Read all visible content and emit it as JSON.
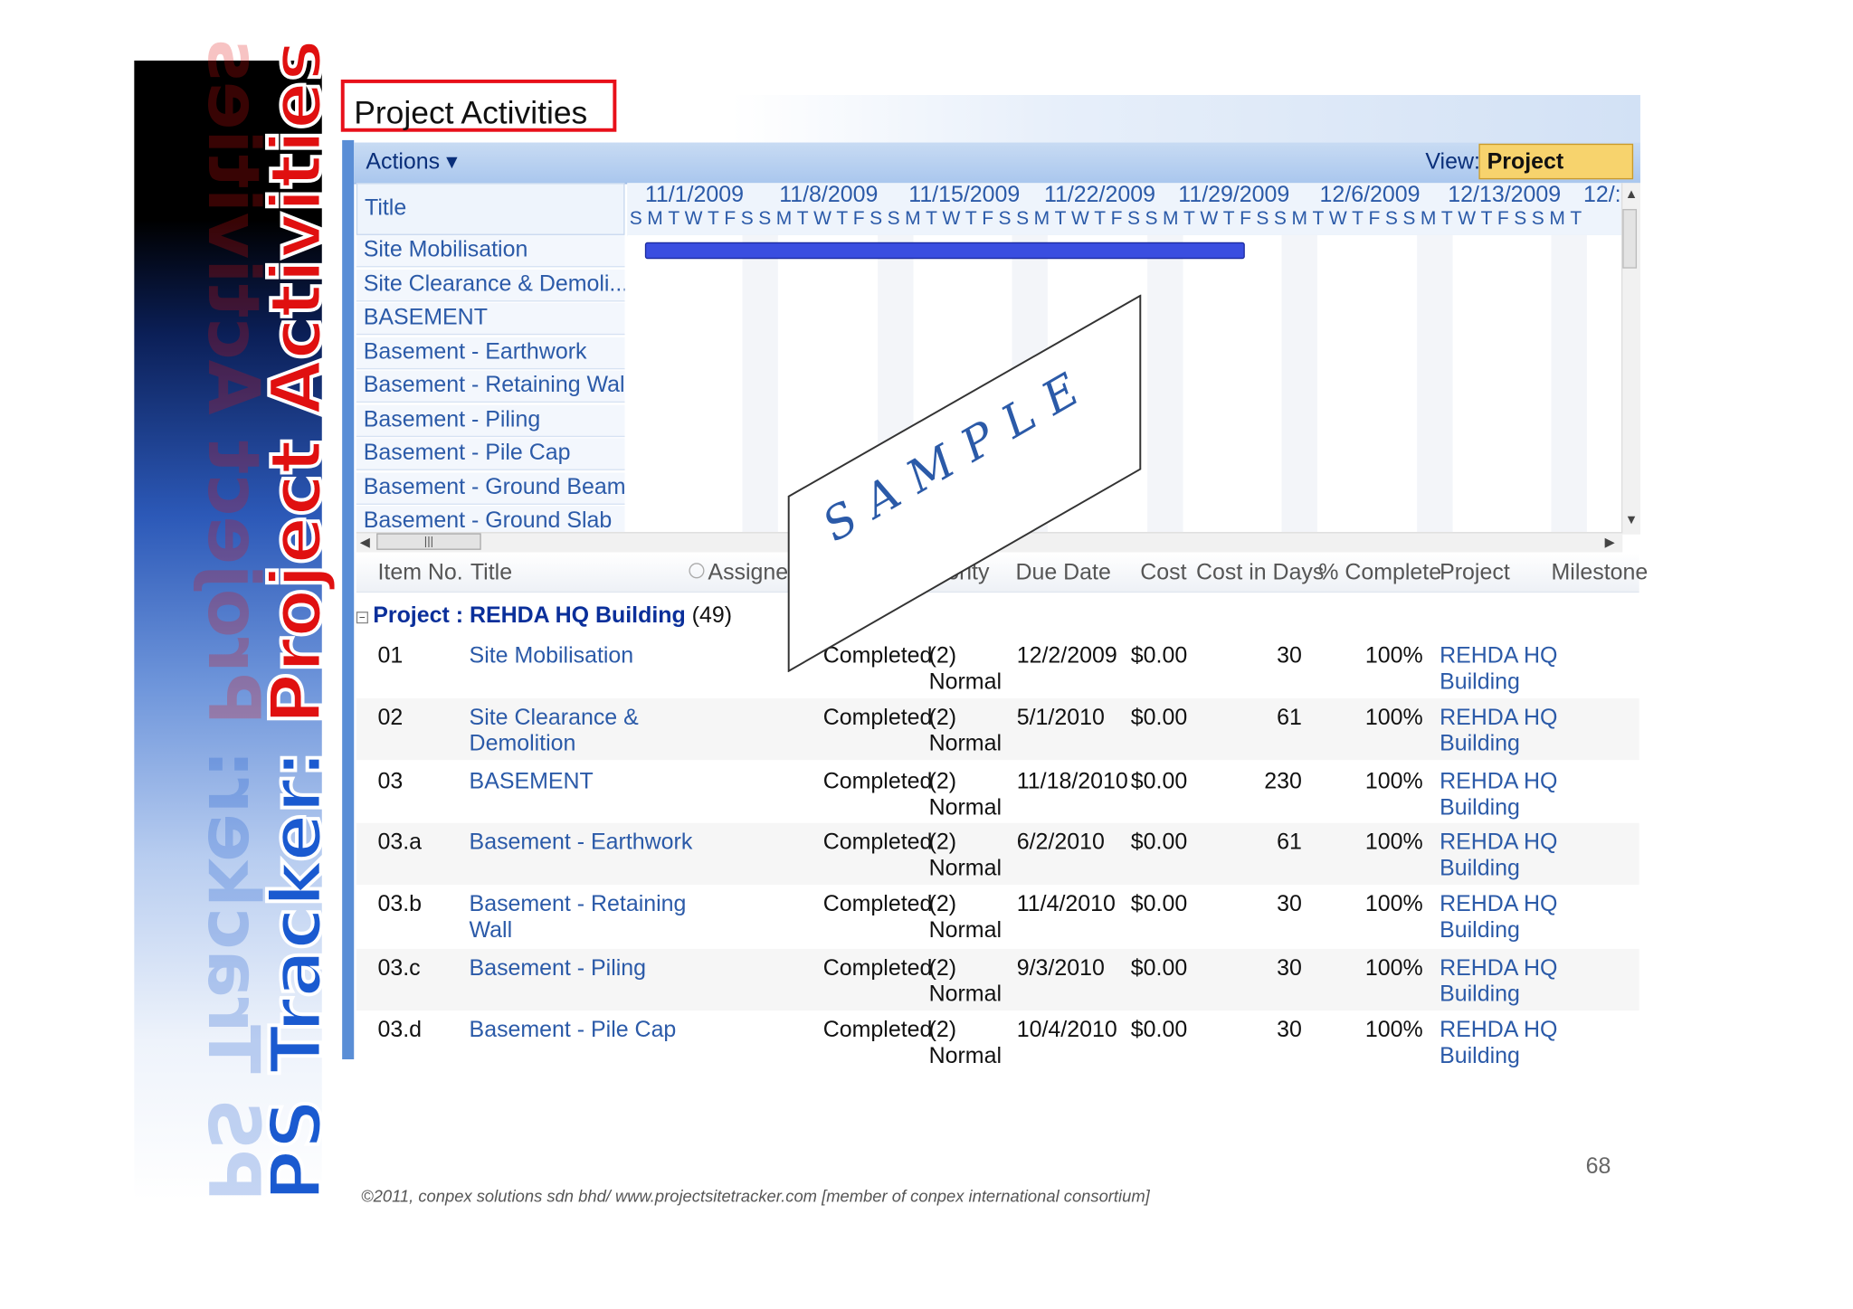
{
  "sidebar": {
    "prefix": "PS Tracker: ",
    "highlight": "Project Activities"
  },
  "panel": {
    "title": "Project Activities",
    "actions": "Actions ▾",
    "view_label": "View:",
    "view_value": "Project Tasks ▾"
  },
  "gantt": {
    "title_header": "Title",
    "weeks": [
      "11/1/2009",
      "11/8/2009",
      "11/15/2009",
      "11/22/2009",
      "11/29/2009",
      "12/6/2009",
      "12/13/2009",
      "12/:"
    ],
    "days": "SMTWTFSSMTWTFSSMTWTFSSMTWTFSSMTWTFSSMTWTFSSMTWTFSSMT",
    "tasks": [
      "Site Mobilisation",
      "Site Clearance & Demoli...",
      "BASEMENT",
      "Basement - Earthwork",
      "Basement - Retaining Wall",
      "Basement - Piling",
      "Basement - Pile Cap",
      "Basement - Ground Beam",
      "Basement - Ground Slab"
    ],
    "scroll_grip": "|||"
  },
  "list": {
    "headers": {
      "item": "Item No.",
      "title": "Title",
      "assigned": "Assigned",
      "priority": "ority",
      "due": "Due Date",
      "cost": "Cost",
      "days": "Cost in Days",
      "pct": "% Complete",
      "project": "Project",
      "milestone": "Milestone"
    },
    "group_label": "Project : REHDA HQ Building",
    "group_count": "(49)",
    "rows": [
      {
        "item": "01",
        "title": "Site Mobilisation",
        "status": "Completed",
        "priority": "(2)\nNormal",
        "due": "12/2/2009",
        "cost": "$0.00",
        "days": "30",
        "pct": "100%",
        "project": "REHDA HQ\nBuilding"
      },
      {
        "item": "02",
        "title": "Site Clearance &\nDemolition",
        "status": "Completed",
        "priority": "(2)\nNormal",
        "due": "5/1/2010",
        "cost": "$0.00",
        "days": "61",
        "pct": "100%",
        "project": "REHDA HQ\nBuilding"
      },
      {
        "item": "03",
        "title": "BASEMENT",
        "status": "Completed",
        "priority": "(2)\nNormal",
        "due": "11/18/2010",
        "cost": "$0.00",
        "days": "230",
        "pct": "100%",
        "project": "REHDA HQ\nBuilding"
      },
      {
        "item": "03.a",
        "title": "Basement - Earthwork",
        "status": "Completed",
        "priority": "(2)\nNormal",
        "due": "6/2/2010",
        "cost": "$0.00",
        "days": "61",
        "pct": "100%",
        "project": "REHDA HQ\nBuilding"
      },
      {
        "item": "03.b",
        "title": "Basement - Retaining\nWall",
        "status": "Completed",
        "priority": "(2)\nNormal",
        "due": "11/4/2010",
        "cost": "$0.00",
        "days": "30",
        "pct": "100%",
        "project": "REHDA HQ\nBuilding"
      },
      {
        "item": "03.c",
        "title": "Basement - Piling",
        "status": "Completed",
        "priority": "(2)\nNormal",
        "due": "9/3/2010",
        "cost": "$0.00",
        "days": "30",
        "pct": "100%",
        "project": "REHDA HQ\nBuilding"
      },
      {
        "item": "03.d",
        "title": "Basement - Pile Cap",
        "status": "Completed",
        "priority": "(2)\nNormal",
        "due": "10/4/2010",
        "cost": "$0.00",
        "days": "30",
        "pct": "100%",
        "project": "REHDA HQ\nBuilding"
      }
    ]
  },
  "watermark": "SAMPLE",
  "footer": "©2011, conpex solutions sdn bhd/ www.projectsitetracker.com [member of conpex international consortium]",
  "page_number": "68",
  "colors": {
    "accent_blue": "#2b5aa8",
    "gantt_bar": "#3a4ee0",
    "title_box": "#e8101a",
    "view_button": "#f7d36d"
  }
}
